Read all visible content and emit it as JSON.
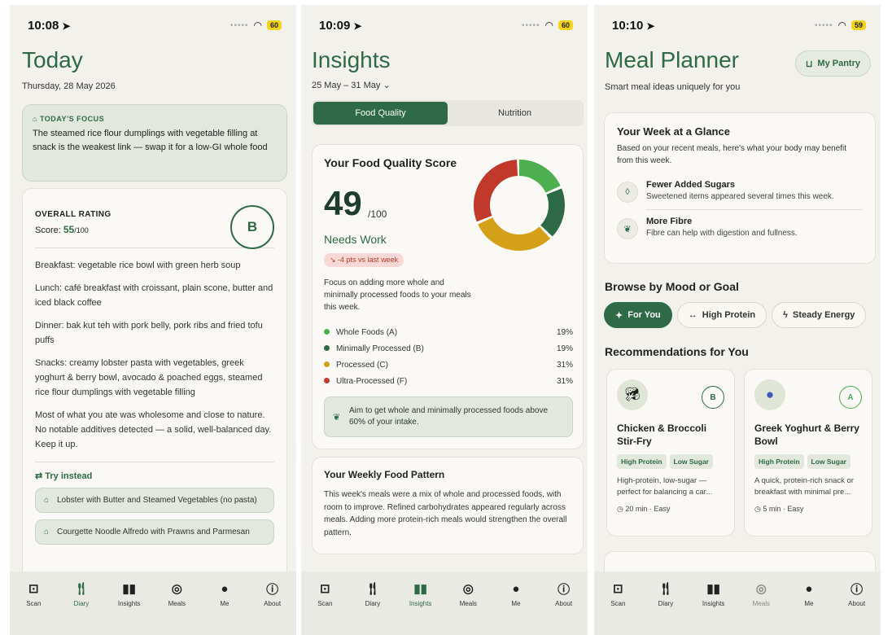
{
  "screens": [
    {
      "status": {
        "time": "10:08",
        "battery": "60"
      },
      "title": "Today",
      "date": "Thursday, 28 May 2026",
      "focus": {
        "label": "TODAY'S FOCUS",
        "text": "The steamed rice flour dumplings with vegetable filling at snack is the weakest link — swap it for a low-GI whole food"
      },
      "rating": {
        "label": "OVERALL RATING",
        "score_prefix": "Score:",
        "score": "55",
        "score_suffix": "/100",
        "grade": "B",
        "meals": [
          "Breakfast: vegetable rice bowl with green herb soup",
          "Lunch: café breakfast with croissant, plain scone, butter and iced black coffee",
          "Dinner: bak kut teh with pork belly, pork ribs and fried tofu puffs",
          "Snacks: creamy lobster pasta with vegetables, greek yoghurt & berry bowl, avocado & poached eggs, steamed rice flour dumplings with vegetable filling",
          "Most of what you ate was wholesome and close to nature. No notable additives detected — a solid, well-balanced day. Keep it up."
        ],
        "try_label": "Try instead",
        "alternatives": [
          "Lobster with Butter and Steamed Vegetables (no pasta)",
          "Courgette Noodle Alfredo with Prawns and Parmesan"
        ]
      }
    },
    {
      "status": {
        "time": "10:09",
        "battery": "60"
      },
      "title": "Insights",
      "date_range": "25 May – 31 May",
      "segments": [
        "Food Quality",
        "Nutrition"
      ],
      "score_card": {
        "title": "Your Food Quality Score",
        "score": "49",
        "out_of": "/100",
        "verdict": "Needs Work",
        "delta": "-4 pts vs last week",
        "description": "Focus on adding more whole and minimally processed foods to your meals this week.",
        "breakdown": [
          {
            "label": "Whole Foods (A)",
            "percent": 19,
            "color": "#4caf50"
          },
          {
            "label": "Minimally Processed (B)",
            "percent": 19,
            "color": "#2d6a45"
          },
          {
            "label": "Processed (C)",
            "percent": 31,
            "color": "#d4a017"
          },
          {
            "label": "Ultra-Processed (F)",
            "percent": 31,
            "color": "#c0392b"
          }
        ],
        "aim": "Aim to get whole and minimally processed foods above 60% of your intake."
      },
      "pattern": {
        "title": "Your Weekly Food Pattern",
        "text": "This week's meals were a mix of whole and processed foods, with room to improve. Refined carbohydrates appeared regularly across meals. Adding more protein-rich meals would strengthen the overall pattern."
      }
    },
    {
      "status": {
        "time": "10:10",
        "battery": "59"
      },
      "title": "Meal Planner",
      "subtitle": "Smart meal ideas uniquely for you",
      "pantry_button": "My Pantry",
      "week": {
        "title": "Your Week at a Glance",
        "intro": "Based on your recent meals, here's what your body may benefit from this week.",
        "benefits": [
          {
            "title": "Fewer Added Sugars",
            "desc": "Sweetened items appeared several times this week.",
            "icon": "droplet-icon"
          },
          {
            "title": "More Fibre",
            "desc": "Fibre can help with digestion and fullness.",
            "icon": "leaf-icon"
          }
        ]
      },
      "browse_title": "Browse by Mood or Goal",
      "chips": [
        "For You",
        "High Protein",
        "Steady Energy"
      ],
      "rec_title": "Recommendations for You",
      "recommendations": [
        {
          "name": "Chicken & Broccoli Stir-Fry",
          "grade": "B",
          "tags": [
            "High Protein",
            "Low Sugar"
          ],
          "desc": "High-protein, low-sugar — perfect for balancing a car...",
          "meta": "20 min · Easy",
          "icon": "broccoli-icon"
        },
        {
          "name": "Greek Yoghurt & Berry Bowl",
          "grade": "A",
          "tags": [
            "High Protein",
            "Low Sugar"
          ],
          "desc": "A quick, protein-rich snack or breakfast with minimal pre...",
          "meta": "5 min · Easy",
          "icon": "blueberries-icon"
        }
      ]
    }
  ],
  "tabs": [
    "Scan",
    "Diary",
    "Insights",
    "Meals",
    "Me",
    "About"
  ],
  "colors": {
    "accent": "#2d6a45",
    "background": "#f3f1ec",
    "card": "#faf9f5",
    "negative": "#c0392b"
  }
}
